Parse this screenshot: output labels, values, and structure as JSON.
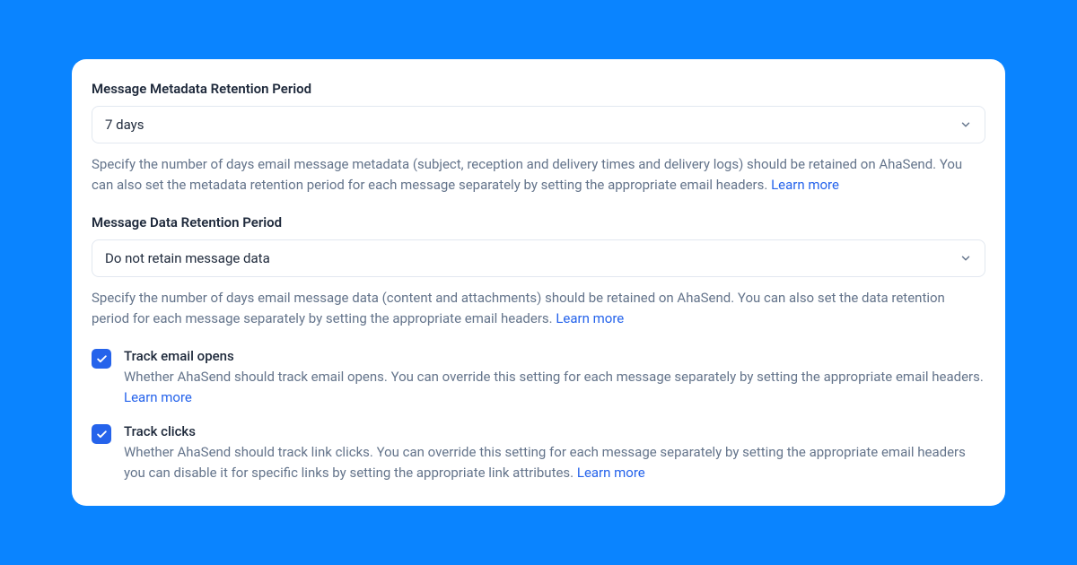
{
  "metadata": {
    "label": "Message Metadata Retention Period",
    "value": "7 days",
    "help": "Specify the number of days email message metadata (subject, reception and delivery times and delivery logs) should be retained on AhaSend. You can also set the metadata retention period for each message separately by setting the appropriate email headers. ",
    "learnMore": "Learn more"
  },
  "data": {
    "label": "Message Data Retention Period",
    "value": "Do not retain message data",
    "help": "Specify the number of days email message data (content and attachments) should be retained on AhaSend. You can also set the data retention period for each message separately by setting the appropriate email headers. ",
    "learnMore": "Learn more"
  },
  "trackOpens": {
    "title": "Track email opens",
    "desc": "Whether AhaSend should track email opens. You can override this setting for each message separately by setting the appropriate email headers. ",
    "learnMore": "Learn more"
  },
  "trackClicks": {
    "title": "Track clicks",
    "desc": "Whether AhaSend should track link clicks. You can override this setting for each message separately by setting the appropriate email headers you can disable it for specific links by setting the appropriate link attributes. ",
    "learnMore": "Learn more"
  }
}
